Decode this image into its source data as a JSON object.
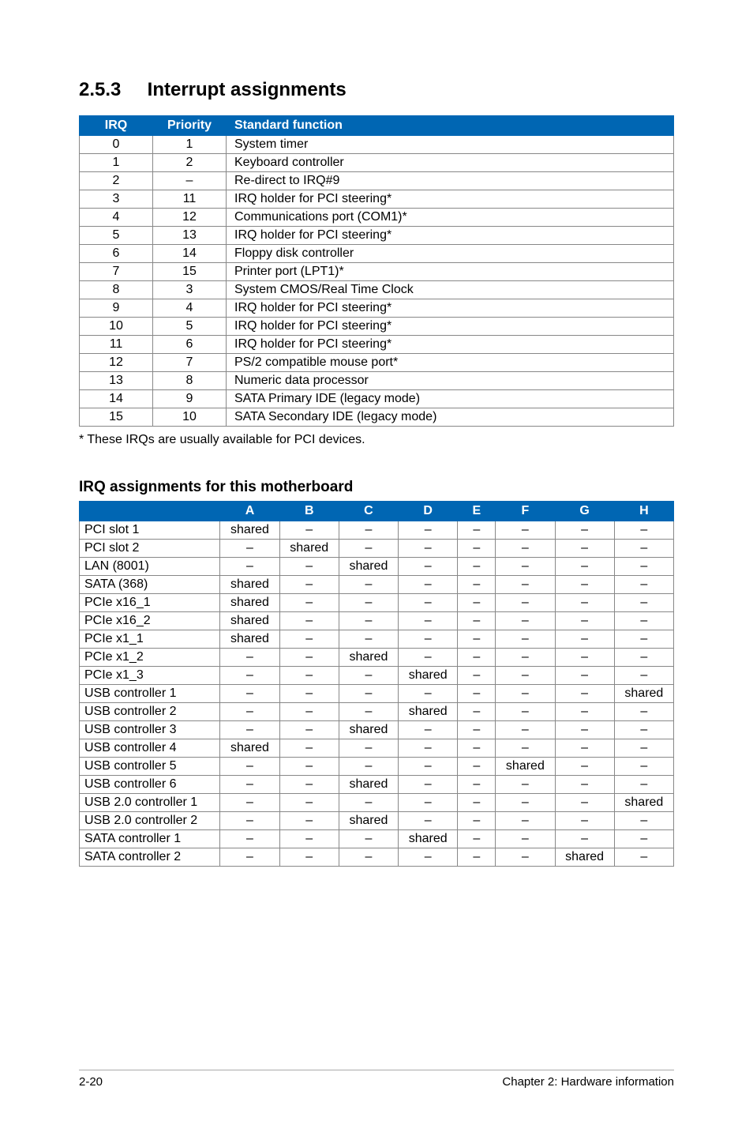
{
  "section": {
    "number": "2.5.3",
    "title": "Interrupt assignments"
  },
  "irq_table": {
    "headers": {
      "irq": "IRQ",
      "priority": "Priority",
      "func": "Standard function"
    },
    "rows": [
      {
        "irq": "0",
        "priority": "1",
        "func": "System timer"
      },
      {
        "irq": "1",
        "priority": "2",
        "func": "Keyboard controller"
      },
      {
        "irq": "2",
        "priority": "–",
        "func": "Re-direct to IRQ#9"
      },
      {
        "irq": "3",
        "priority": "11",
        "func": "IRQ holder for PCI steering*"
      },
      {
        "irq": "4",
        "priority": "12",
        "func": "Communications port (COM1)*"
      },
      {
        "irq": "5",
        "priority": "13",
        "func": "IRQ holder for PCI steering*"
      },
      {
        "irq": "6",
        "priority": "14",
        "func": "Floppy disk controller"
      },
      {
        "irq": "7",
        "priority": "15",
        "func": "Printer port (LPT1)*"
      },
      {
        "irq": "8",
        "priority": "3",
        "func": "System CMOS/Real Time Clock"
      },
      {
        "irq": "9",
        "priority": "4",
        "func": "IRQ holder for PCI steering*"
      },
      {
        "irq": "10",
        "priority": "5",
        "func": "IRQ holder for PCI steering*"
      },
      {
        "irq": "11",
        "priority": "6",
        "func": "IRQ holder for PCI steering*"
      },
      {
        "irq": "12",
        "priority": "7",
        "func": "PS/2 compatible mouse port*"
      },
      {
        "irq": "13",
        "priority": "8",
        "func": "Numeric data processor"
      },
      {
        "irq": "14",
        "priority": "9",
        "func": "SATA Primary IDE (legacy mode)"
      },
      {
        "irq": "15",
        "priority": "10",
        "func": "SATA Secondary IDE (legacy mode)"
      }
    ]
  },
  "footnote": "* These IRQs are usually available for PCI devices.",
  "subheading": "IRQ assignments for this motherboard",
  "mb_table": {
    "cols": [
      "A",
      "B",
      "C",
      "D",
      "E",
      "F",
      "G",
      "H"
    ],
    "rows": [
      {
        "label": "PCI slot 1",
        "cells": [
          "shared",
          "–",
          "–",
          "–",
          "–",
          "–",
          "–",
          "–"
        ]
      },
      {
        "label": "PCI slot 2",
        "cells": [
          "–",
          "shared",
          "–",
          "–",
          "–",
          "–",
          "–",
          "–"
        ]
      },
      {
        "label": "LAN (8001)",
        "cells": [
          "–",
          "–",
          "shared",
          "–",
          "–",
          "–",
          "–",
          "–"
        ]
      },
      {
        "label": "SATA (368)",
        "cells": [
          "shared",
          "–",
          "–",
          "–",
          "–",
          "–",
          "–",
          "–"
        ]
      },
      {
        "label": "PCIe x16_1",
        "cells": [
          "shared",
          "–",
          "–",
          "–",
          "–",
          "–",
          "–",
          "–"
        ]
      },
      {
        "label": "PCIe x16_2",
        "cells": [
          "shared",
          "–",
          "–",
          "–",
          "–",
          "–",
          "–",
          "–"
        ]
      },
      {
        "label": "PCIe x1_1",
        "cells": [
          "shared",
          "–",
          "–",
          "–",
          "–",
          "–",
          "–",
          "–"
        ]
      },
      {
        "label": "PCIe x1_2",
        "cells": [
          "–",
          "–",
          "shared",
          "–",
          "–",
          "–",
          "–",
          "–"
        ]
      },
      {
        "label": "PCIe x1_3",
        "cells": [
          "–",
          "–",
          "–",
          "shared",
          "–",
          "–",
          "–",
          "–"
        ]
      },
      {
        "label": "USB controller 1",
        "cells": [
          "–",
          "–",
          "–",
          "–",
          "–",
          "–",
          "–",
          "shared"
        ]
      },
      {
        "label": "USB controller 2",
        "cells": [
          "–",
          "–",
          "–",
          "shared",
          "–",
          "–",
          "–",
          "–"
        ]
      },
      {
        "label": "USB controller 3",
        "cells": [
          "–",
          "–",
          "shared",
          "–",
          "–",
          "–",
          "–",
          "–"
        ]
      },
      {
        "label": "USB controller 4",
        "cells": [
          "shared",
          "–",
          "–",
          "–",
          "–",
          "–",
          "–",
          "–"
        ]
      },
      {
        "label": "USB controller 5",
        "cells": [
          "–",
          "–",
          "–",
          "–",
          "–",
          "shared",
          "–",
          "–"
        ]
      },
      {
        "label": "USB controller 6",
        "cells": [
          "–",
          "–",
          "shared",
          "–",
          "–",
          "–",
          "–",
          "–"
        ]
      },
      {
        "label": "USB 2.0 controller 1",
        "cells": [
          "–",
          "–",
          "–",
          "–",
          "–",
          "–",
          "–",
          "shared"
        ]
      },
      {
        "label": "USB 2.0 controller 2",
        "cells": [
          "–",
          "–",
          "shared",
          "–",
          "–",
          "–",
          "–",
          "–"
        ]
      },
      {
        "label": "SATA controller 1",
        "cells": [
          "–",
          "–",
          "–",
          "shared",
          "–",
          "–",
          "–",
          "–"
        ]
      },
      {
        "label": "SATA controller 2",
        "cells": [
          "–",
          "–",
          "–",
          "–",
          "–",
          "–",
          "shared",
          "–"
        ]
      }
    ]
  },
  "footer": {
    "left": "2-20",
    "right": "Chapter 2: Hardware information"
  }
}
